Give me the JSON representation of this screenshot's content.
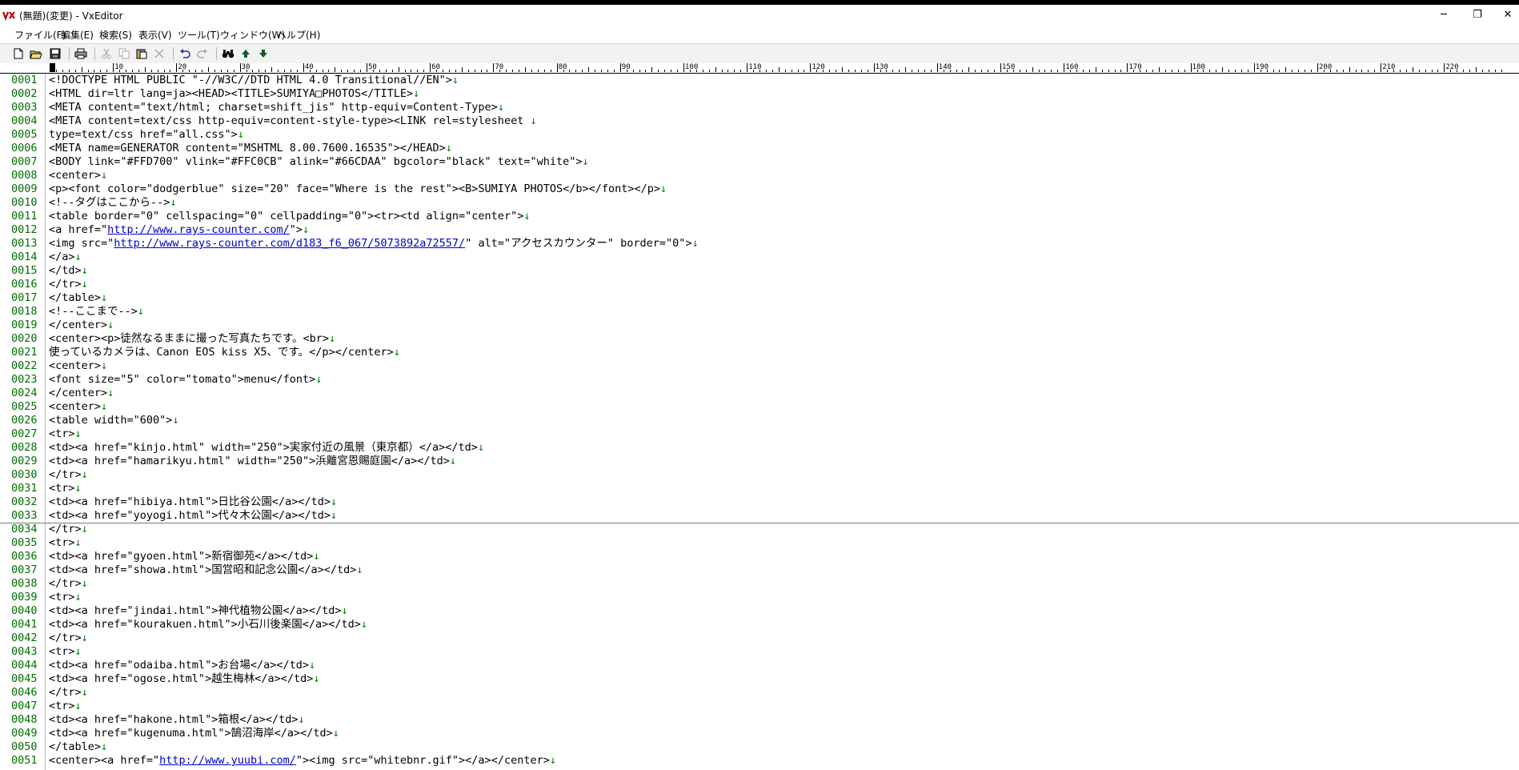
{
  "window": {
    "title": "(無題)(変更) - VxEditor",
    "minimize": "─",
    "restore": "❐",
    "close": "✕"
  },
  "menu": [
    "ファイル(F)",
    "編集(E)",
    "検索(S)",
    "表示(V)",
    "ツール(T)",
    "ウィンドウ(W)",
    "ヘルプ(H)"
  ],
  "toolbar_icons": [
    "new-file-icon",
    "open-folder-icon",
    "save-icon",
    "print-icon",
    "cut-icon",
    "copy-icon",
    "paste-icon",
    "delete-icon",
    "undo-icon",
    "redo-icon",
    "find-icon",
    "find-prev-icon",
    "find-next-icon"
  ],
  "ruler": {
    "marks": [
      "0",
      "10",
      "20",
      "30",
      "40",
      "50",
      "60",
      "70",
      "80",
      "90",
      "100",
      "110",
      "120",
      "130",
      "140",
      "150",
      "160",
      "170",
      "180",
      "190",
      "200",
      "210",
      "220"
    ]
  },
  "editor": {
    "newline_mark": "↓",
    "lines": [
      {
        "n": "0001",
        "t": "<!DOCTYPE HTML PUBLIC \"-//W3C//DTD HTML 4.0 Transitional//EN\">"
      },
      {
        "n": "0002",
        "t": "<HTML dir=ltr lang=ja><HEAD><TITLE>SUMIYA□PHOTOS</TITLE>"
      },
      {
        "n": "0003",
        "t": "<META content=\"text/html; charset=shift_jis\" http-equiv=Content-Type>"
      },
      {
        "n": "0004",
        "t": "<META content=text/css http-equiv=content-style-type><LINK rel=stylesheet "
      },
      {
        "n": "0005",
        "t": "type=text/css href=\"all.css\">"
      },
      {
        "n": "0006",
        "t": "<META name=GENERATOR content=\"MSHTML 8.00.7600.16535\"></HEAD>"
      },
      {
        "n": "0007",
        "t": "<BODY link=\"#FFD700\" vlink=\"#FFC0CB\" alink=\"#66CDAA\" bgcolor=\"black\" text=\"white\">"
      },
      {
        "n": "0008",
        "t": "<center>"
      },
      {
        "n": "0009",
        "t": "<p><font color=\"dodgerblue\" size=\"20\" face=\"Where is the rest\"><B>SUMIYA PHOTOS</b></font></p>"
      },
      {
        "n": "0010",
        "t": "<!--タグはここから-->"
      },
      {
        "n": "0011",
        "t": "<table border=\"0\" cellspacing=\"0\" cellpadding=\"0\"><tr><td align=\"center\">"
      },
      {
        "n": "0012",
        "t": "<a href=\"",
        "url": "http://www.rays-counter.com/",
        "after": "\">"
      },
      {
        "n": "0013",
        "t": "<img src=\"",
        "url": "http://www.rays-counter.com/d183_f6_067/5073892a72557/",
        "after": "\" alt=\"アクセスカウンター\" border=\"0\">"
      },
      {
        "n": "0014",
        "t": "</a>"
      },
      {
        "n": "0015",
        "t": "</td>"
      },
      {
        "n": "0016",
        "t": "</tr>"
      },
      {
        "n": "0017",
        "t": "</table>"
      },
      {
        "n": "0018",
        "t": "<!--ここまで-->"
      },
      {
        "n": "0019",
        "t": "</center>"
      },
      {
        "n": "0020",
        "t": "<center><p>徒然なるままに撮った写真たちです。<br>"
      },
      {
        "n": "0021",
        "t": "使っているカメラは、Canon EOS kiss X5、です。</p></center>"
      },
      {
        "n": "0022",
        "t": "<center>"
      },
      {
        "n": "0023",
        "t": "<font size=\"5\" color=\"tomato\">menu</font>"
      },
      {
        "n": "0024",
        "t": "</center>"
      },
      {
        "n": "0025",
        "t": "<center>"
      },
      {
        "n": "0026",
        "t": "<table width=\"600\">"
      },
      {
        "n": "0027",
        "t": "<tr>"
      },
      {
        "n": "0028",
        "t": "<td><a href=\"kinjo.html\" width=\"250\">実家付近の風景（東京都）</a></td>"
      },
      {
        "n": "0029",
        "t": "<td><a href=\"hamarikyu.html\" width=\"250\">浜離宮恩賜庭園</a></td>"
      },
      {
        "n": "0030",
        "t": "</tr>"
      },
      {
        "n": "0031",
        "t": "<tr>"
      },
      {
        "n": "0032",
        "t": "<td><a href=\"hibiya.html\">日比谷公園</a></td>"
      },
      {
        "n": "0033",
        "t": "<td><a href=\"yoyogi.html\">代々木公園</a></td>"
      },
      {
        "n": "0034",
        "t": "</tr>"
      },
      {
        "n": "0035",
        "t": "<tr>"
      },
      {
        "n": "0036",
        "t": "<td><a href=\"gyoen.html\">新宿御苑</a></td>"
      },
      {
        "n": "0037",
        "t": "<td><a href=\"showa.html\">国営昭和記念公園</a></td>"
      },
      {
        "n": "0038",
        "t": "</tr>"
      },
      {
        "n": "0039",
        "t": "<tr>"
      },
      {
        "n": "0040",
        "t": "<td><a href=\"jindai.html\">神代植物公園</a></td>"
      },
      {
        "n": "0041",
        "t": "<td><a href=\"kourakuen.html\">小石川後楽園</a></td>"
      },
      {
        "n": "0042",
        "t": "</tr>"
      },
      {
        "n": "0043",
        "t": "<tr>"
      },
      {
        "n": "0044",
        "t": "<td><a href=\"odaiba.html\">お台場</a></td>"
      },
      {
        "n": "0045",
        "t": "<td><a href=\"ogose.html\">越生梅林</a></td>"
      },
      {
        "n": "0046",
        "t": "</tr>"
      },
      {
        "n": "0047",
        "t": "<tr>"
      },
      {
        "n": "0048",
        "t": "<td><a href=\"hakone.html\">箱根</a></td>"
      },
      {
        "n": "0049",
        "t": "<td><a href=\"kugenuma.html\">鵠沼海岸</a></td>"
      },
      {
        "n": "0050",
        "t": "</table>"
      },
      {
        "n": "0051",
        "t": "<center><a href=\"",
        "url": "http://www.yuubi.com/",
        "after": "\"><img src=\"whitebnr.gif\"></a></center>"
      }
    ]
  }
}
